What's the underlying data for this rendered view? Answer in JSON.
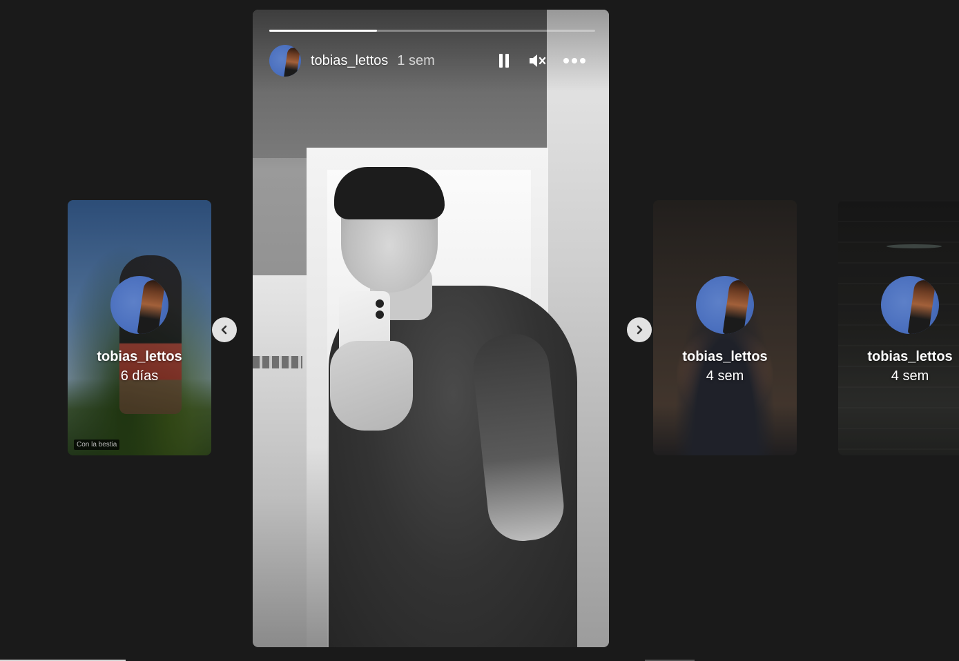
{
  "colors": {
    "background": "#1a1a1a",
    "avatar_blue": "#4a6fbe",
    "nav_button": "#e2e2e2"
  },
  "story": {
    "username": "tobias_lettos",
    "time": "1 sem",
    "progress": 0.33,
    "controls": {
      "pause_icon": "pause-icon",
      "mute_icon": "volume-muted-icon",
      "more_icon": "more-options-icon"
    }
  },
  "navigation": {
    "prev_icon": "chevron-left-icon",
    "next_icon": "chevron-right-icon"
  },
  "tray": [
    {
      "username": "tobias_lettos",
      "time": "6 días",
      "caption": "Con la bestia"
    },
    {
      "username": "tobias_lettos",
      "time": "4 sem"
    },
    {
      "username": "tobias_lettos",
      "time": "4 sem"
    }
  ]
}
